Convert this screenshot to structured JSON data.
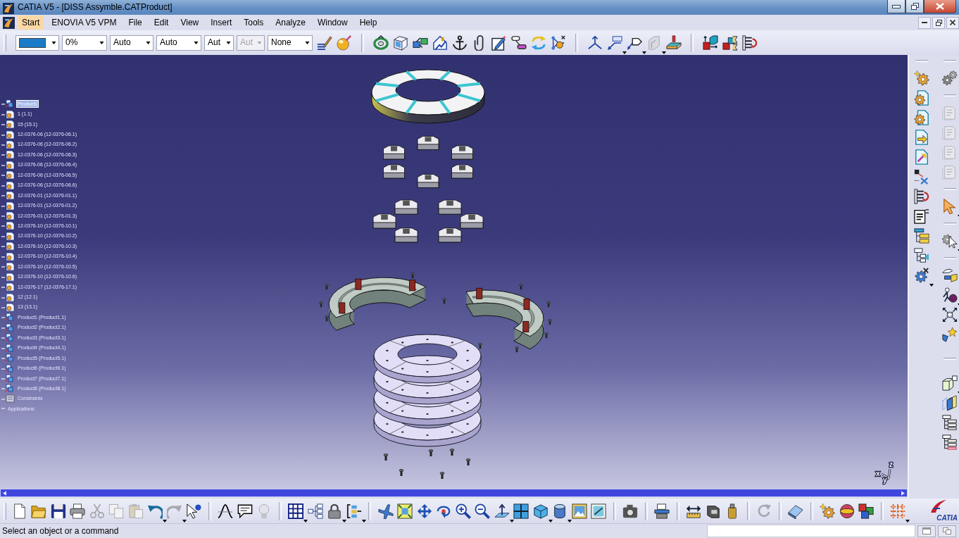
{
  "window": {
    "title": "CATIA V5 - [DISS Assymble.CATProduct]"
  },
  "menu": [
    {
      "label": "Start",
      "selected": true
    },
    {
      "label": "ENOVIA V5 VPM",
      "selected": false
    },
    {
      "label": "File",
      "selected": false
    },
    {
      "label": "Edit",
      "selected": false
    },
    {
      "label": "View",
      "selected": false
    },
    {
      "label": "Insert",
      "selected": false
    },
    {
      "label": "Tools",
      "selected": false
    },
    {
      "label": "Analyze",
      "selected": false
    },
    {
      "label": "Window",
      "selected": false
    },
    {
      "label": "Help",
      "selected": false
    }
  ],
  "graphic_properties": [
    {
      "kind": "color",
      "color": "#1a7cc8",
      "disabled": false
    },
    {
      "kind": "text",
      "value": "0%",
      "disabled": false
    },
    {
      "kind": "text",
      "value": "Auto",
      "disabled": false
    },
    {
      "kind": "text",
      "value": "Auto",
      "disabled": false
    },
    {
      "kind": "text",
      "value": "Aut",
      "disabled": false
    },
    {
      "kind": "text",
      "value": "Aut",
      "disabled": true
    },
    {
      "kind": "text",
      "value": "None",
      "disabled": false
    }
  ],
  "tree": {
    "label": "Product1",
    "kind": "product",
    "selected": true,
    "children": [
      {
        "label": "1 (1.1)",
        "kind": "part",
        "selected": false
      },
      {
        "label": "15 (15.1)",
        "kind": "part",
        "selected": false
      },
      {
        "label": "12-0376-06 (12-0376-06.1)",
        "kind": "part",
        "selected": false
      },
      {
        "label": "12-0376-06 (12-0376-06.2)",
        "kind": "part",
        "selected": false
      },
      {
        "label": "12-0376-06 (12-0376-06.3)",
        "kind": "part",
        "selected": false
      },
      {
        "label": "12-0376-06 (12-0376-06.4)",
        "kind": "part",
        "selected": false
      },
      {
        "label": "12-0376-06 (12-0376-06.5)",
        "kind": "part",
        "selected": false
      },
      {
        "label": "12-0376-06 (12-0376-06.6)",
        "kind": "part",
        "selected": false
      },
      {
        "label": "12-0376-01 (12-0376-01.1)",
        "kind": "part",
        "selected": false
      },
      {
        "label": "12-0376-01 (12-0376-01.2)",
        "kind": "part",
        "selected": false
      },
      {
        "label": "12-0376-01 (12-0376-01.3)",
        "kind": "part",
        "selected": false
      },
      {
        "label": "12-0376-10 (12-0376-10.1)",
        "kind": "part",
        "selected": false
      },
      {
        "label": "12-0376-10 (12-0376-10.2)",
        "kind": "part",
        "selected": false
      },
      {
        "label": "12-0376-10 (12-0376-10.3)",
        "kind": "part",
        "selected": false
      },
      {
        "label": "12-0376-10 (12-0376-10.4)",
        "kind": "part",
        "selected": false
      },
      {
        "label": "12-0376-10 (12-0376-10.5)",
        "kind": "part",
        "selected": false
      },
      {
        "label": "12-0376-10 (12-0376-10.6)",
        "kind": "part",
        "selected": false
      },
      {
        "label": "12-0376-17 (12-0376-17.1)",
        "kind": "part",
        "selected": false
      },
      {
        "label": "12 (12.1)",
        "kind": "part",
        "selected": false
      },
      {
        "label": "13 (13.1)",
        "kind": "part",
        "selected": false
      },
      {
        "label": "Product1 (Product1.1)",
        "kind": "product",
        "selected": false
      },
      {
        "label": "Product2 (Product2.1)",
        "kind": "product",
        "selected": false
      },
      {
        "label": "Product3 (Product3.1)",
        "kind": "product",
        "selected": false
      },
      {
        "label": "Product4 (Product4.1)",
        "kind": "product",
        "selected": false
      },
      {
        "label": "Product5 (Product5.1)",
        "kind": "product",
        "selected": false
      },
      {
        "label": "Product6 (Product6.1)",
        "kind": "product",
        "selected": false
      },
      {
        "label": "Product7 (Product7.1)",
        "kind": "product",
        "selected": false
      },
      {
        "label": "Product8 (Product8.1)",
        "kind": "product",
        "selected": false
      },
      {
        "label": "Constraints",
        "kind": "constraints",
        "selected": false
      },
      {
        "label": "Applications",
        "kind": "applications",
        "selected": false
      }
    ]
  },
  "compass": {
    "axis_labels": [
      "z",
      "x",
      "y"
    ]
  },
  "logo": {
    "text": "CATIA"
  },
  "status_bar": {
    "message": "Select an object or a command"
  }
}
